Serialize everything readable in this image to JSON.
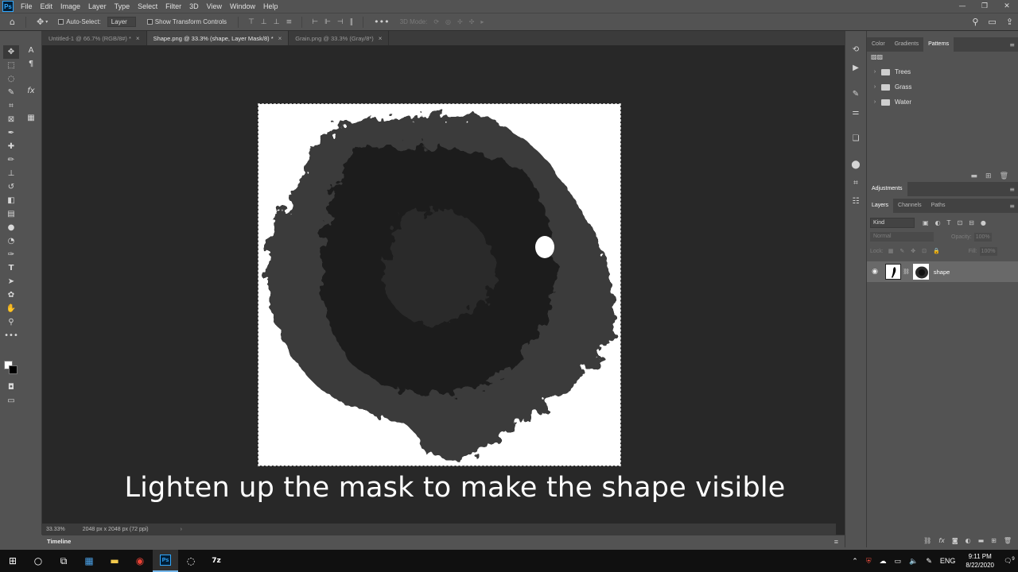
{
  "app": {
    "logo_text": "Ps",
    "menu": [
      "File",
      "Edit",
      "Image",
      "Layer",
      "Type",
      "Select",
      "Filter",
      "3D",
      "View",
      "Window",
      "Help"
    ]
  },
  "options_bar": {
    "auto_select_label": "Auto-Select:",
    "auto_select_value": "Layer",
    "show_transform_label": "Show Transform Controls",
    "mode_3d_label": "3D Mode:"
  },
  "tabs": [
    {
      "label": "Untitled-1 @ 66.7% (RGB/8#) *",
      "active": false
    },
    {
      "label": "Shape.png @ 33.3% (shape, Layer Mask/8) *",
      "active": true
    },
    {
      "label": "Grain.png @ 33.3% (Gray/8*)",
      "active": false
    }
  ],
  "canvas": {
    "caption": "Lighten up the mask to make the shape visible"
  },
  "status": {
    "zoom": "33.33%",
    "dimensions": "2048 px x 2048 px (72 ppi)"
  },
  "timeline": {
    "label": "Timeline"
  },
  "patterns_panel": {
    "tabs": [
      "Color",
      "Gradients",
      "Patterns"
    ],
    "active_tab": "Patterns",
    "folders": [
      "Trees",
      "Grass",
      "Water"
    ]
  },
  "adjustments_panel": {
    "title": "Adjustments"
  },
  "layers_panel": {
    "tabs": [
      "Layers",
      "Channels",
      "Paths"
    ],
    "filter_kind": "Kind",
    "blend_mode": "Normal",
    "opacity_label": "Opacity:",
    "opacity_value": "100%",
    "lock_label": "Lock:",
    "fill_label": "Fill:",
    "fill_value": "100%",
    "layers": [
      {
        "name": "shape",
        "visible": true
      }
    ]
  },
  "taskbar": {
    "language": "ENG",
    "time": "9:11 PM",
    "date": "8/22/2020",
    "notification_count": "9"
  },
  "colors": {
    "ui_gray": "#535353",
    "canvas_bg": "#282828",
    "ps_blue": "#31a8ff"
  }
}
